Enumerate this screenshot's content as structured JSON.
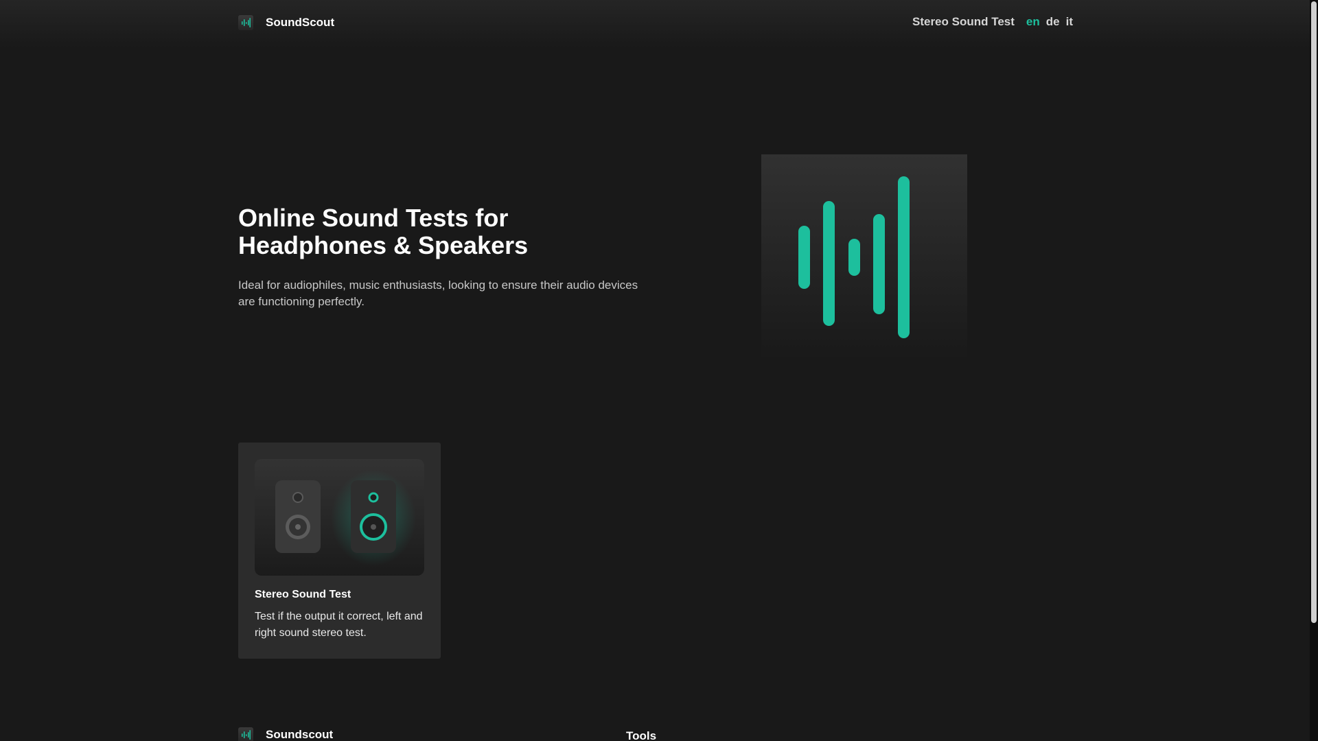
{
  "header": {
    "brand": "SoundScout",
    "nav_link": "Stereo Sound Test",
    "languages": [
      "en",
      "de",
      "it"
    ],
    "active_language": "en"
  },
  "hero": {
    "title": "Online Sound Tests for Headphones & Speakers",
    "subtitle": "Ideal for audiophiles, music enthusiasts, looking to ensure their audio devices are functioning perfectly.",
    "art_icon": "waveform-icon"
  },
  "tools": [
    {
      "title": "Stereo Sound Test",
      "description": "Test if the output it correct, left and right sound stereo test.",
      "icon": "stereo-speakers-icon"
    }
  ],
  "footer": {
    "brand": "Soundscout",
    "column_title": "Tools"
  },
  "colors": {
    "background": "#191919",
    "accent": "#1dbf9d",
    "card": "#2c2c2c"
  }
}
